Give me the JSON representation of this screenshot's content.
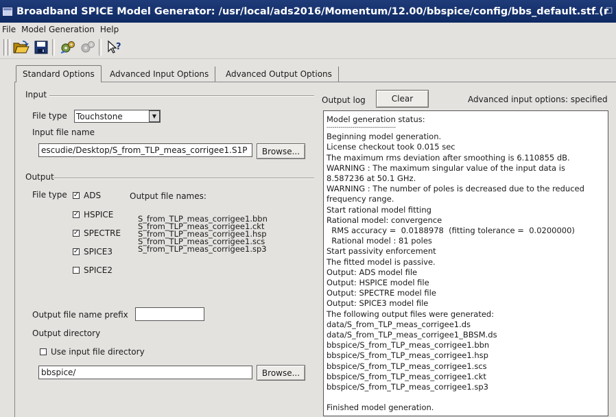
{
  "window": {
    "title": "Broadband SPICE Model Generator: /usr/local/ads2016/Momentum/12.00/bbspice/config/bbs_default.stf (r",
    "buttons": [
      "_",
      "□"
    ]
  },
  "menu": [
    "File",
    "Model Generation",
    "Help"
  ],
  "toolbar": [
    "open-folder-icon",
    "save-icon",
    "gears-icon",
    "gears-disabled-icon",
    "whats-this-icon"
  ],
  "tabs": [
    "Standard Options",
    "Advanced Input Options",
    "Advanced Output Options"
  ],
  "input_group": {
    "title": "Input",
    "file_type_label": "File type",
    "file_type_value": "Touchstone",
    "input_file_label": "Input file name",
    "input_file_value": "escudie/Desktop/S_from_TLP_meas_corrigee1.S1P",
    "browse_label": "Browse..."
  },
  "output_group": {
    "title": "Output",
    "file_type_label": "File type",
    "output_files_label": "Output file names:",
    "formats": [
      {
        "label": "ADS",
        "checked": true
      },
      {
        "label": "HSPICE",
        "checked": true
      },
      {
        "label": "SPECTRE",
        "checked": true
      },
      {
        "label": "SPICE3",
        "checked": true
      },
      {
        "label": "SPICE2",
        "checked": false
      }
    ],
    "file_names": [
      "S_from_TLP_meas_corrigee1.bbn",
      "S_from_TLP_meas_corrigee1.ckt",
      "S_from_TLP_meas_corrigee1.hsp",
      "S_from_TLP_meas_corrigee1.scs",
      "S_from_TLP_meas_corrigee1.sp3"
    ],
    "prefix_label": "Output file name prefix",
    "prefix_value": "",
    "dir_label": "Output directory",
    "use_input_dir_label": "Use input file directory",
    "use_input_dir_checked": false,
    "dir_value": "bbspice/",
    "browse_label": "Browse..."
  },
  "log": {
    "label": "Output log",
    "clear_label": "Clear",
    "status_text": "Advanced input options: specified",
    "lines": [
      "Model generation status:",
      "-----------------------------------",
      "Beginning model generation.",
      "License checkout took 0.015 sec",
      "The maximum rms deviation after smoothing is 6.110855 dB.",
      "WARNING : The maximum singular value of the input data is",
      "8.587236 at 50.1 GHz.",
      "WARNING : The number of poles is decreased due to the reduced",
      "frequency range.",
      "Start rational model fitting",
      "Rational model: convergence",
      "  RMS accuracy =  0.0188978  (fitting tolerance =  0.0200000)",
      "  Rational model : 81 poles",
      "Start passivity enforcement",
      "The fitted model is passive.",
      "Output: ADS model file",
      "Output: HSPICE model file",
      "Output: SPECTRE model file",
      "Output: SPICE3 model file",
      "The following output files were generated:",
      "data/S_from_TLP_meas_corrigee1.ds",
      "data/S_from_TLP_meas_corrigee1_BBSM.ds",
      "bbspice/S_from_TLP_meas_corrigee1.bbn",
      "bbspice/S_from_TLP_meas_corrigee1.hsp",
      "bbspice/S_from_TLP_meas_corrigee1.scs",
      "bbspice/S_from_TLP_meas_corrigee1.ckt",
      "bbspice/S_from_TLP_meas_corrigee1.sp3",
      "",
      "Finished model generation."
    ]
  }
}
